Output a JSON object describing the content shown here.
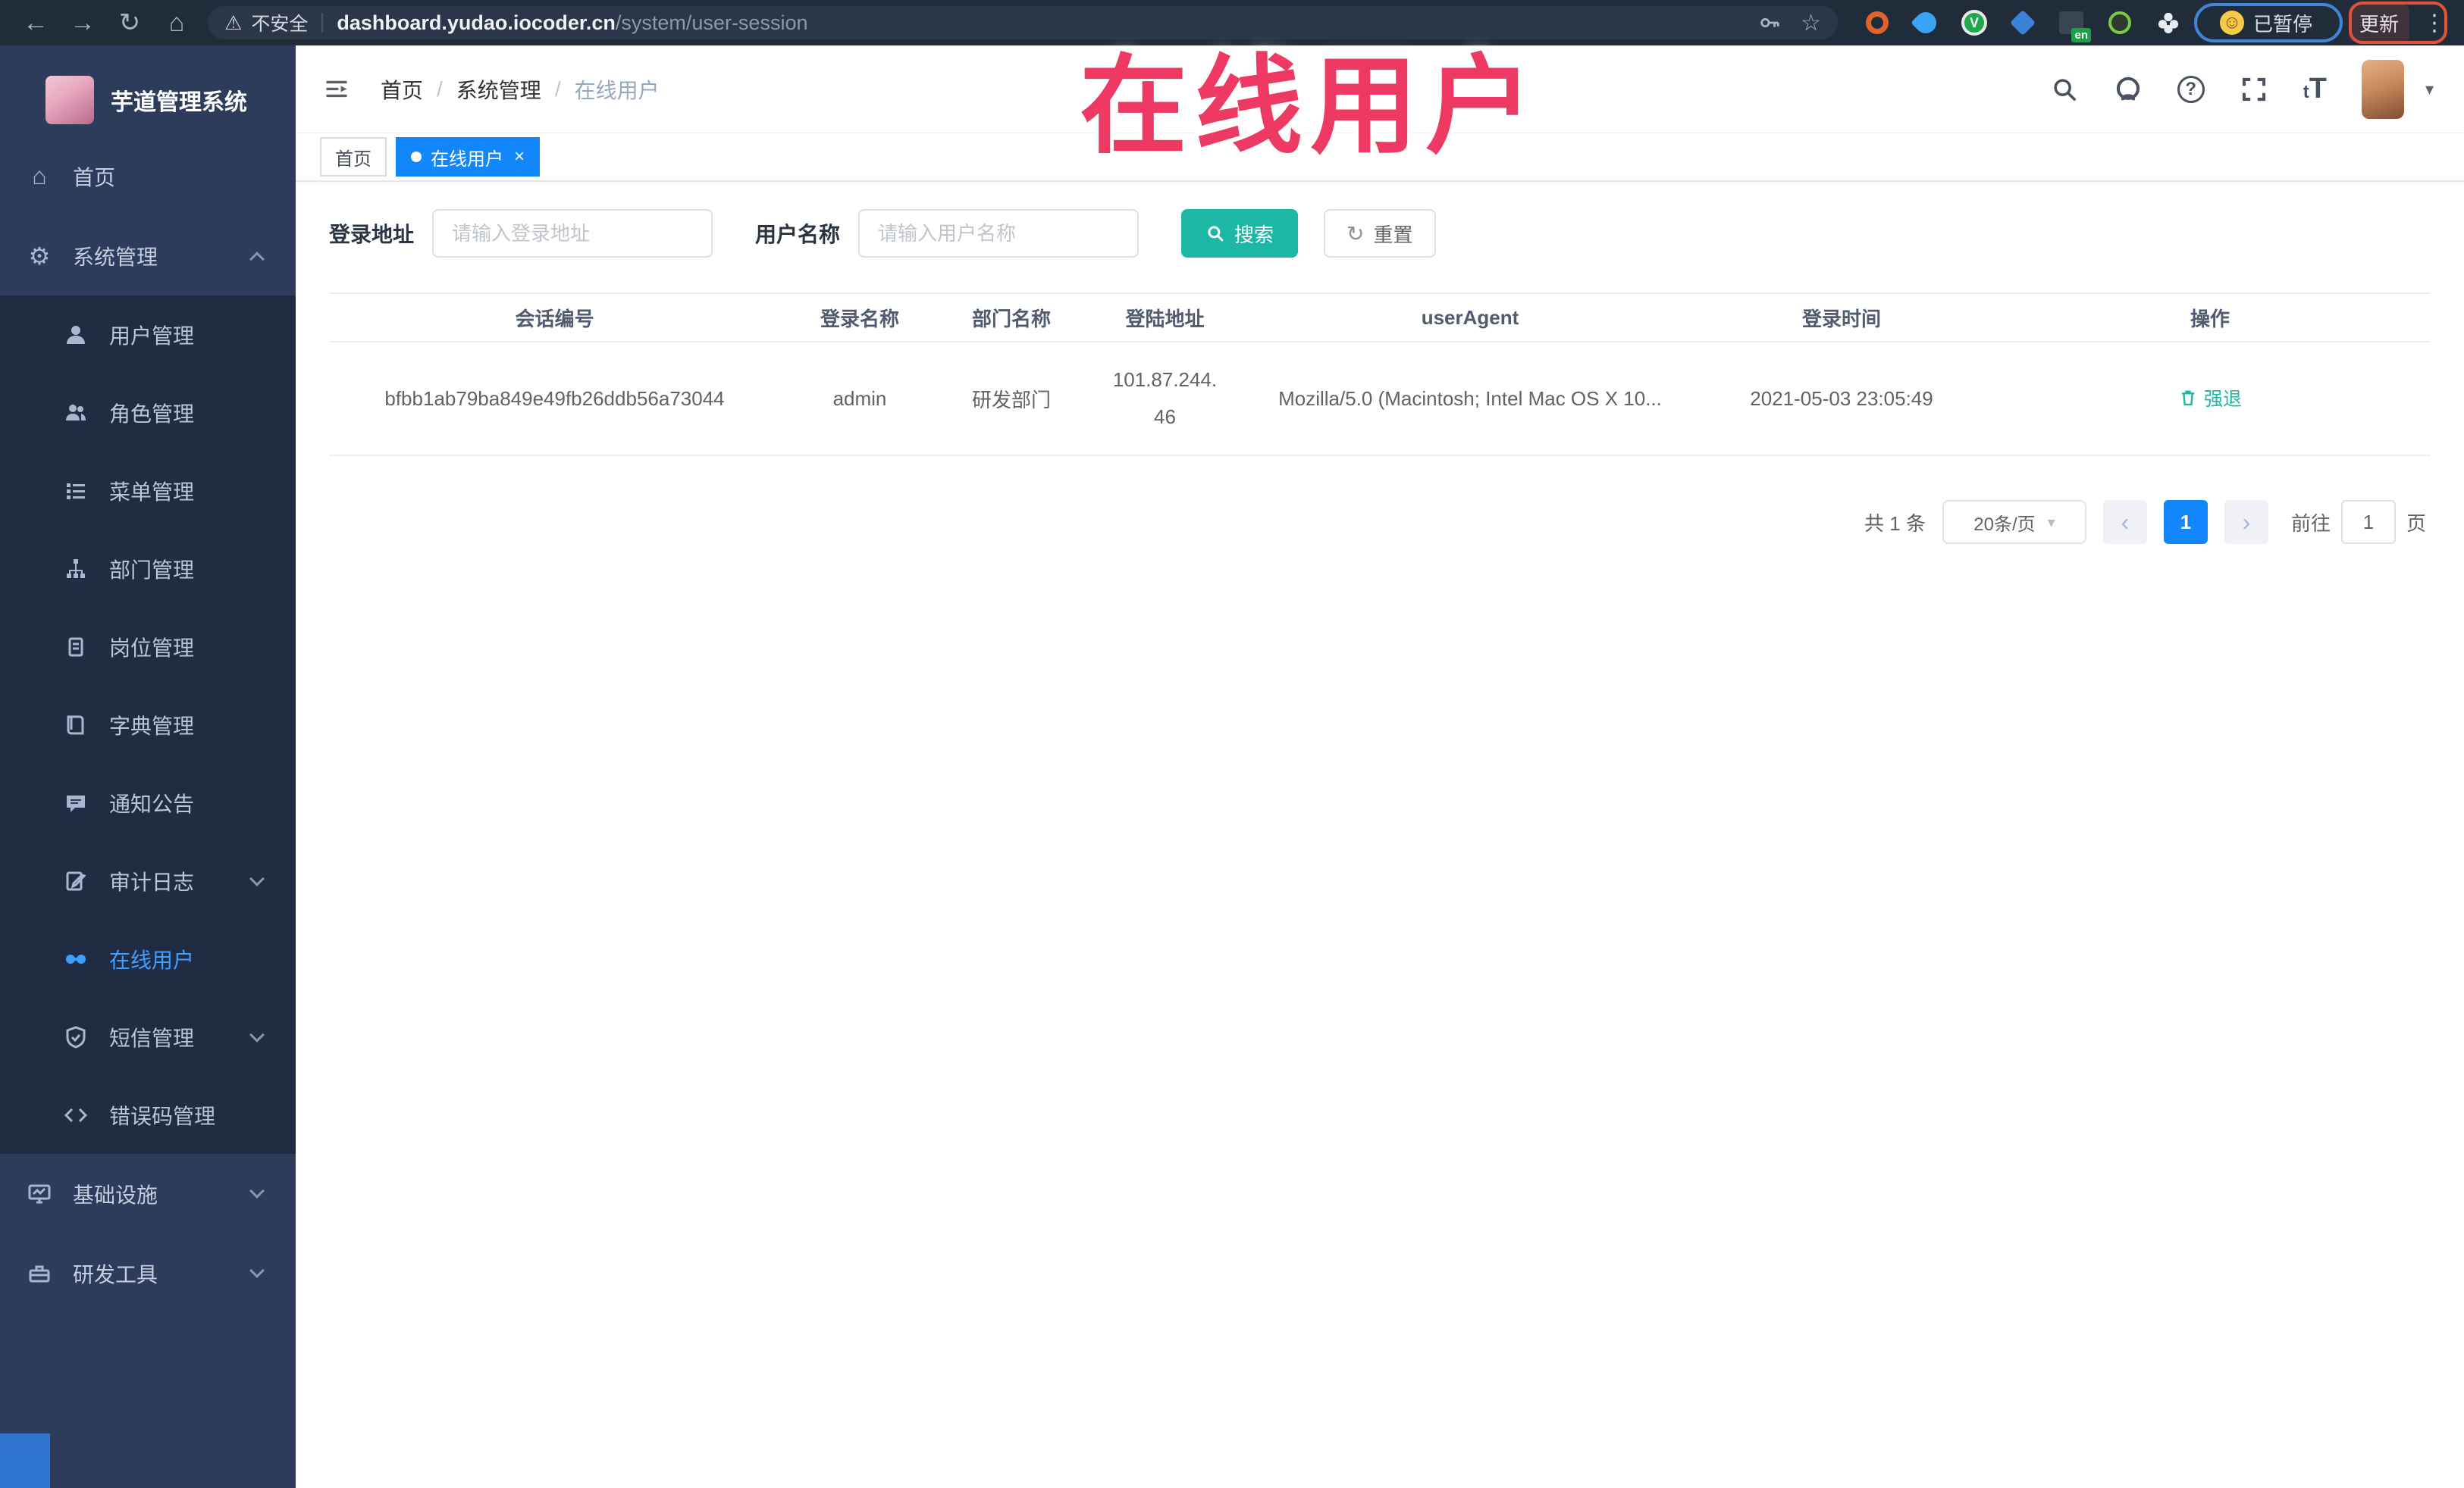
{
  "browser": {
    "security_label": "不安全",
    "url_domain": "dashboard.yudao.iocoder.cn",
    "url_path": "/system/user-session",
    "extension_badge": "en",
    "extension_letter": "V",
    "paused_label": "已暂停",
    "update_label": "更新"
  },
  "watermark": {
    "text": "在线用户"
  },
  "sidebar": {
    "logo_title": "芋道管理系统",
    "items": {
      "home": "首页",
      "system": "系统管理",
      "infra": "基础设施",
      "devtools": "研发工具"
    },
    "system_submenu": [
      "用户管理",
      "角色管理",
      "菜单管理",
      "部门管理",
      "岗位管理",
      "字典管理",
      "通知公告",
      "审计日志",
      "在线用户",
      "短信管理",
      "错误码管理"
    ],
    "active_item": "在线用户"
  },
  "header": {
    "breadcrumb": [
      "首页",
      "系统管理",
      "在线用户"
    ],
    "separator": "/"
  },
  "tags": {
    "home": "首页",
    "active": "在线用户"
  },
  "filters": {
    "login_addr_label": "登录地址",
    "login_addr_placeholder": "请输入登录地址",
    "username_label": "用户名称",
    "username_placeholder": "请输入用户名称",
    "search_label": "搜索",
    "reset_label": "重置"
  },
  "table": {
    "columns": [
      "会话编号",
      "登录名称",
      "部门名称",
      "登陆地址",
      "userAgent",
      "登录时间",
      "操作"
    ],
    "rows": [
      {
        "session_id": "bfbb1ab79ba849e49fb26ddb56a73044",
        "login_name": "admin",
        "dept_name": "研发部门",
        "ip_line1": "101.87.244.",
        "ip_line2": "46",
        "user_agent": "Mozilla/5.0 (Macintosh; Intel Mac OS X 10...",
        "login_time": "2021-05-03 23:05:49",
        "action_label": "强退"
      }
    ]
  },
  "pagination": {
    "total_label": "共 1 条",
    "page_size_label": "20条/页",
    "current_page": "1",
    "goto_label": "前往",
    "goto_value": "1",
    "page_unit_label": "页"
  },
  "colors": {
    "primary": "#409eff",
    "active_tab_blue": "#1286fb",
    "button_teal": "#1db8a5",
    "sidebar_bg": "#2e3c5c",
    "sidebar_submenu_bg": "#202c44",
    "watermark_red": "#ee3a62"
  }
}
